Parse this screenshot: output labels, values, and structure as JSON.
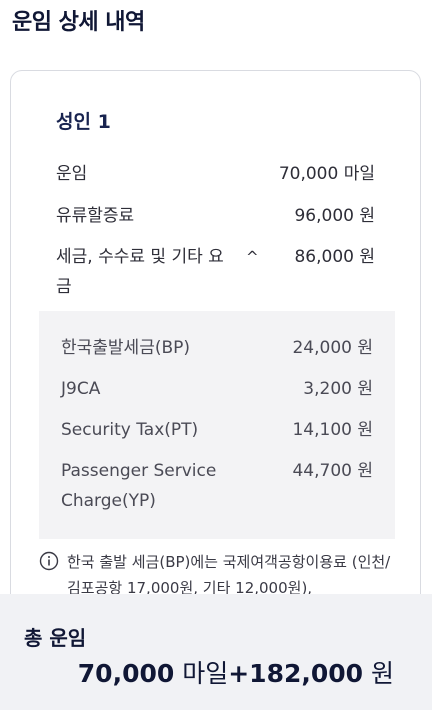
{
  "page_title": "운임 상세 내역",
  "passenger": {
    "label": "성인 1"
  },
  "fare": {
    "label": "운임",
    "value": "70,000 마일"
  },
  "fuel": {
    "label": "유류할증료",
    "value": "96,000 원"
  },
  "taxes": {
    "label": "세금, 수수료 및 기타 요금",
    "toggle": "^",
    "value": "86,000 원",
    "items": [
      {
        "label": "한국출발세금(BP)",
        "value": "24,000 원"
      },
      {
        "label": "J9CA",
        "value": "3,200 원"
      },
      {
        "label": "Security Tax(PT)",
        "value": "14,100 원"
      },
      {
        "label": "Passenger Service Charge(YP)",
        "value": "44,700 원"
      }
    ]
  },
  "notice": {
    "icon": "info-icon",
    "text": "한국 출발 세금(BP)에는 국제여객공항이용료 (인천/김포공항 17,000원, 기타 12,000원),"
  },
  "total": {
    "label": "총 운임",
    "miles": "70,000",
    "miles_unit": " 마일",
    "plus": "+",
    "won": "182,000",
    "won_unit": " 원"
  },
  "colors": {
    "title": "#101735",
    "accent": "#18234f",
    "breakdown_bg": "#f3f3f5",
    "total_bg": "#f1f2f5"
  }
}
